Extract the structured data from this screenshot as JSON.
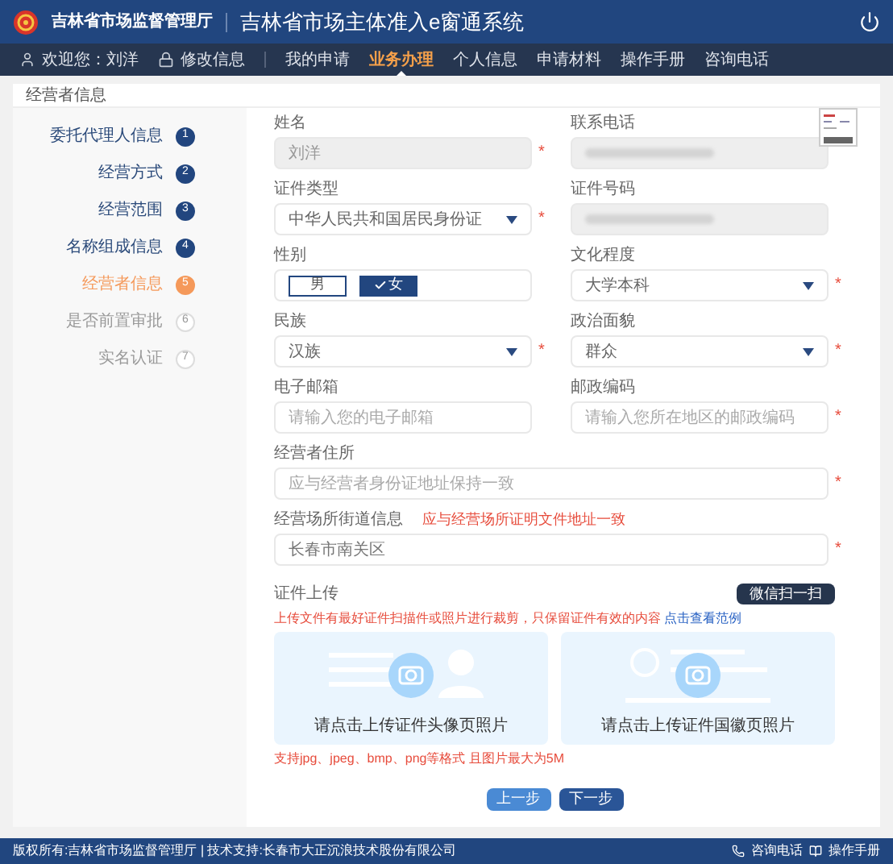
{
  "header": {
    "agency": "吉林省市场监督管理厅",
    "title": "吉林省市场主体准入e窗通系统"
  },
  "nav": {
    "user": "欢迎您：刘洋",
    "edit": "修改信息",
    "items": [
      {
        "label": "我的申请",
        "selected": false
      },
      {
        "label": "业务办理",
        "selected": true
      },
      {
        "label": "个人信息",
        "selected": false
      },
      {
        "label": "申请材料",
        "selected": false
      },
      {
        "label": "操作手册",
        "selected": false
      },
      {
        "label": "咨询电话",
        "selected": false
      }
    ]
  },
  "section_title": "经营者信息",
  "steps": [
    {
      "number": "1",
      "label": "委托代理人信息",
      "kind": "done"
    },
    {
      "number": "2",
      "label": "经营方式",
      "kind": "done"
    },
    {
      "number": "3",
      "label": "经营范围",
      "kind": "done"
    },
    {
      "number": "4",
      "label": "名称组成信息",
      "kind": "done"
    },
    {
      "number": "5",
      "label": "经营者信息",
      "kind": "current"
    },
    {
      "number": "6",
      "label": "是否前置审批",
      "kind": "todo"
    },
    {
      "number": "7",
      "label": "实名认证",
      "kind": "todo"
    }
  ],
  "fields": [
    {
      "label": "姓名",
      "kind": "readonly",
      "value": "刘洋",
      "mark": "*"
    },
    {
      "label": "联系电话",
      "kind": "redacted"
    },
    {
      "label": "证件类型",
      "kind": "select",
      "value": "中华人民共和国居民身份证",
      "mark": "*"
    },
    {
      "label": "证件号码",
      "kind": "redacted"
    },
    {
      "label": "性别",
      "kind": "gender",
      "options": [
        {
          "label": "男",
          "selected": false
        },
        {
          "label": "女",
          "selected": true
        }
      ]
    },
    {
      "label": "文化程度",
      "kind": "select",
      "value": "大学本科",
      "mark": "*"
    },
    {
      "label": "民族",
      "kind": "select",
      "value": "汉族",
      "mark": "*"
    },
    {
      "label": "政治面貌",
      "kind": "select",
      "value": "群众",
      "mark": "*"
    },
    {
      "label": "电子邮箱",
      "kind": "input",
      "placeholder": "请输入您的电子邮箱"
    },
    {
      "label": "邮政编码",
      "kind": "input",
      "placeholder": "请输入您所在地区的邮政编码",
      "mark": "*"
    },
    {
      "label": "经营者住所",
      "kind": "input",
      "placeholder": "应与经营者身份证地址保持一致",
      "mark": "*",
      "wide": true
    },
    {
      "label": "经营场所街道信息",
      "kind": "input",
      "value": "长春市南关区",
      "mark": "*",
      "wide": true,
      "hint": "应与经营场所证明文件地址一致"
    }
  ],
  "upload": {
    "title": "证件上传",
    "scan_button": "微信扫一扫",
    "hint": "上传文件有最好证件扫描件或照片进行裁剪，只保留证件有效的内容",
    "hint_link": "点击查看范例",
    "slots": [
      {
        "label": "请点击上传证件头像页照片",
        "kind": "front"
      },
      {
        "label": "请点击上传证件国徽页照片",
        "kind": "back"
      }
    ],
    "formats": "支持jpg、jpeg、bmp、png等格式 且图片最大为5M"
  },
  "buttons": [
    {
      "label": "上一步",
      "kind": "secondary"
    },
    {
      "label": "下一步",
      "kind": "primary"
    }
  ],
  "footer": {
    "copyright": "版权所有:吉林省市场监督管理厅 | 技术支持:长春市大正沉浪技术股份有限公司",
    "phone": "咨询电话",
    "manual": "操作手册"
  }
}
